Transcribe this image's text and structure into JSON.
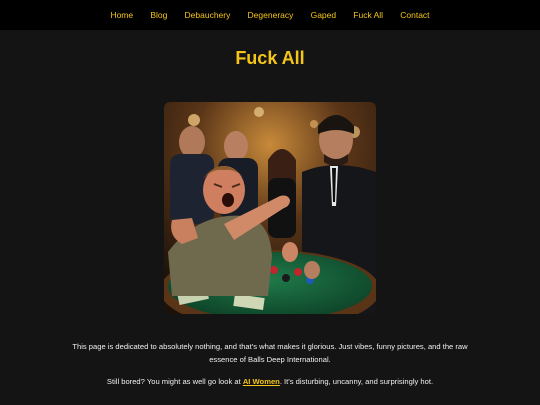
{
  "nav": {
    "items": [
      {
        "label": "Home"
      },
      {
        "label": "Blog"
      },
      {
        "label": "Debauchery"
      },
      {
        "label": "Degeneracy"
      },
      {
        "label": "Gaped"
      },
      {
        "label": "Fuck All"
      },
      {
        "label": "Contact"
      }
    ]
  },
  "page": {
    "title": "Fuck All",
    "paragraph1": "This page is dedicated to absolutely nothing, and that's what makes it glorious. Just vibes, funny pictures, and the raw essence of Balls Deep International.",
    "paragraph2_before": "Still bored? You might as well go look at ",
    "paragraph2_link": "AI Women",
    "paragraph2_after": ". It's disturbing, uncanny, and surprisingly hot."
  },
  "colors": {
    "accent": "#f5c518",
    "nav_bg": "#000000",
    "page_bg": "#141414"
  }
}
